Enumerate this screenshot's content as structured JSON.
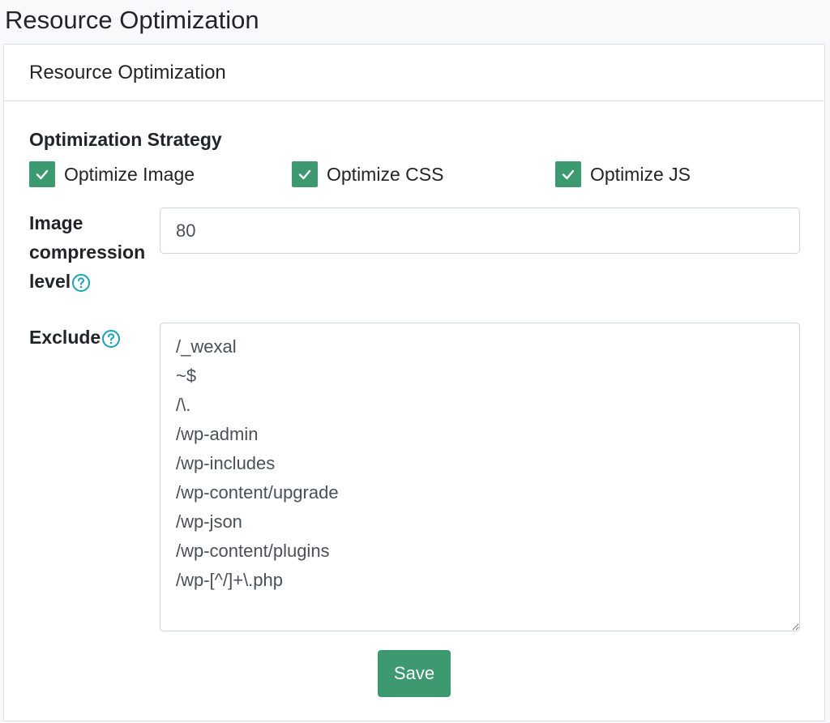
{
  "page": {
    "title": "Resource Optimization"
  },
  "card": {
    "header_title": "Resource Optimization"
  },
  "strategy": {
    "label": "Optimization Strategy",
    "options": [
      {
        "label": "Optimize Image",
        "checked": true
      },
      {
        "label": "Optimize CSS",
        "checked": true
      },
      {
        "label": "Optimize JS",
        "checked": true
      }
    ]
  },
  "compression": {
    "label": "Image compression level",
    "value": "80"
  },
  "exclude": {
    "label": "Exclude",
    "value": "/_wexal\n~$\n/\\.\n/wp-admin\n/wp-includes\n/wp-content/upgrade\n/wp-json\n/wp-content/plugins\n/wp-[^/]+\\.php"
  },
  "actions": {
    "save_label": "Save"
  },
  "colors": {
    "accent": "#3d9970",
    "help_icon": "#17a2b8"
  },
  "icons": {
    "checkbox": "check-icon",
    "help": "question-circle-icon"
  }
}
